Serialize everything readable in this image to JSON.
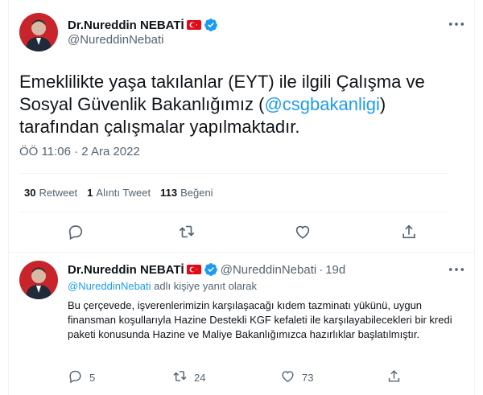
{
  "main_tweet": {
    "author_name": "Dr.Nureddin NEBATİ",
    "handle": "@NureddinNebati",
    "text_part1": "Emeklilikte yaşa takılanlar (EYT) ile ilgili Çalışma ve Sosyal Güvenlik Bakanlığımız (",
    "mention": "@csgbakanligi",
    "text_part2": ") tarafından çalışmalar yapılmaktadır.",
    "timestamp": "ÖÖ 11:06 · 2 Ara 2022",
    "stats": {
      "retweets_count": "30",
      "retweets_label": "Retweet",
      "quotes_count": "1",
      "quotes_label": "Alıntı Tweet",
      "likes_count": "113",
      "likes_label": "Beğeni"
    }
  },
  "reply_tweet": {
    "author_name": "Dr.Nureddin NEBATİ",
    "handle": "@NureddinNebati",
    "dot": "·",
    "time": "19d",
    "replying_mention": "@NureddinNebati",
    "replying_suffix": " adlı kişiye yanıt olarak",
    "text": "Bu çerçevede, işverenlerimizin karşılaşacağı kıdem tazminatı yükünü, uygun finansman koşullarıyla Hazine Destekli KGF kefaleti ile karşılayabilecekleri bir kredi paketi konusunda Hazine ve Maliye Bakanlığımızca hazırlıklar başlatılmıştır.",
    "counts": {
      "replies": "5",
      "retweets": "24",
      "likes": "73"
    }
  },
  "colors": {
    "accent": "#1d9bf0",
    "secondary_text": "#536471",
    "divider": "#eff3f4",
    "flag_red": "#e30a17"
  }
}
